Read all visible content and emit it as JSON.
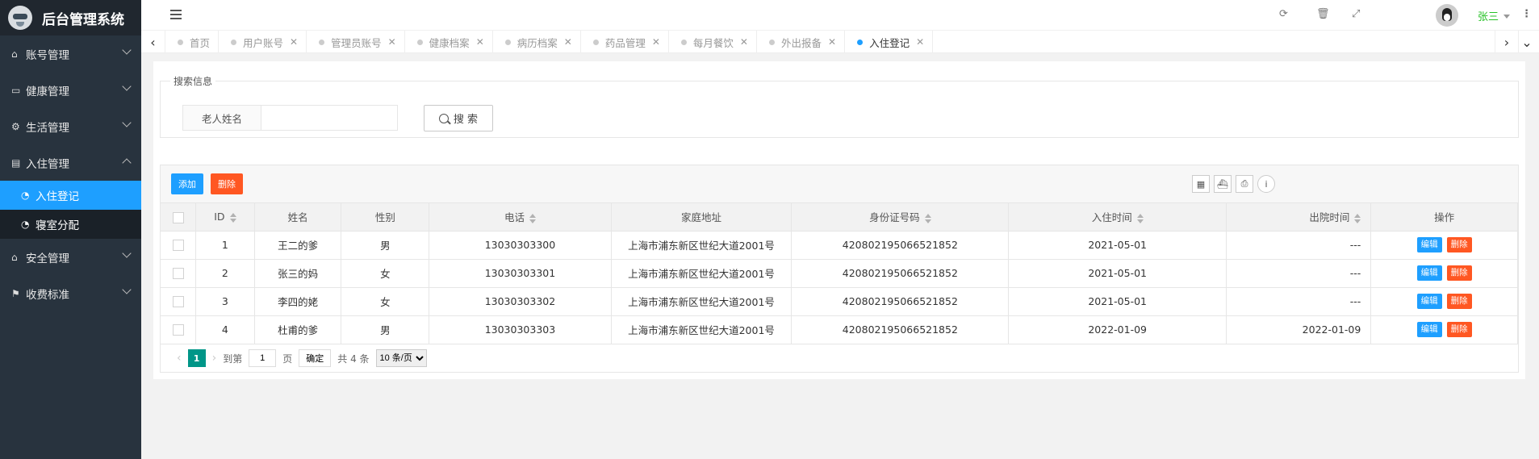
{
  "app": {
    "title": "后台管理系统"
  },
  "sidebar": {
    "items": [
      {
        "label": "账号管理",
        "icon": "home-icon"
      },
      {
        "label": "健康管理",
        "icon": "window-icon"
      },
      {
        "label": "生活管理",
        "icon": "gears-icon"
      },
      {
        "label": "入住管理",
        "icon": "file-icon",
        "expanded": true
      },
      {
        "label": "安全管理",
        "icon": "bank-icon"
      },
      {
        "label": "收费标准",
        "icon": "flag-icon"
      }
    ],
    "subitems": [
      {
        "label": "入住登记",
        "active": true
      },
      {
        "label": "寝室分配",
        "active": false
      }
    ]
  },
  "header": {
    "username": "张三"
  },
  "tabs": [
    {
      "label": "首页",
      "closable": false
    },
    {
      "label": "用户账号",
      "closable": true
    },
    {
      "label": "管理员账号",
      "closable": true
    },
    {
      "label": "健康档案",
      "closable": true
    },
    {
      "label": "病历档案",
      "closable": true
    },
    {
      "label": "药品管理",
      "closable": true
    },
    {
      "label": "每月餐饮",
      "closable": true
    },
    {
      "label": "外出报备",
      "closable": true
    },
    {
      "label": "入住登记",
      "closable": true,
      "active": true
    }
  ],
  "search": {
    "legend": "搜索信息",
    "field_label": "老人姓名",
    "field_value": "",
    "button_label": "搜 索"
  },
  "toolbar": {
    "add_label": "添加",
    "delete_label": "删除"
  },
  "table": {
    "headers": [
      "ID",
      "姓名",
      "性别",
      "电话",
      "家庭地址",
      "身份证号码",
      "入住时间",
      "出院时间",
      "操作"
    ],
    "rows": [
      {
        "id": "1",
        "name": "王二的爹",
        "gender": "男",
        "phone": "13030303300",
        "address": "上海市浦东新区世纪大道2001号",
        "idcard": "420802195066521852",
        "checkin": "2021-05-01",
        "checkout": "---"
      },
      {
        "id": "2",
        "name": "张三的妈",
        "gender": "女",
        "phone": "13030303301",
        "address": "上海市浦东新区世纪大道2001号",
        "idcard": "420802195066521852",
        "checkin": "2021-05-01",
        "checkout": "---"
      },
      {
        "id": "3",
        "name": "李四的姥",
        "gender": "女",
        "phone": "13030303302",
        "address": "上海市浦东新区世纪大道2001号",
        "idcard": "420802195066521852",
        "checkin": "2021-05-01",
        "checkout": "---"
      },
      {
        "id": "4",
        "name": "杜甫的爹",
        "gender": "男",
        "phone": "13030303303",
        "address": "上海市浦东新区世纪大道2001号",
        "idcard": "420802195066521852",
        "checkin": "2022-01-09",
        "checkout": "2022-01-09"
      }
    ],
    "edit_label": "编辑",
    "delete_label": "删除"
  },
  "pager": {
    "current_page": "1",
    "goto_label": "到第",
    "goto_value": "1",
    "page_label": "页",
    "confirm_label": "确定",
    "total_label": "共 4 条",
    "page_size_label": "10 条/页"
  }
}
